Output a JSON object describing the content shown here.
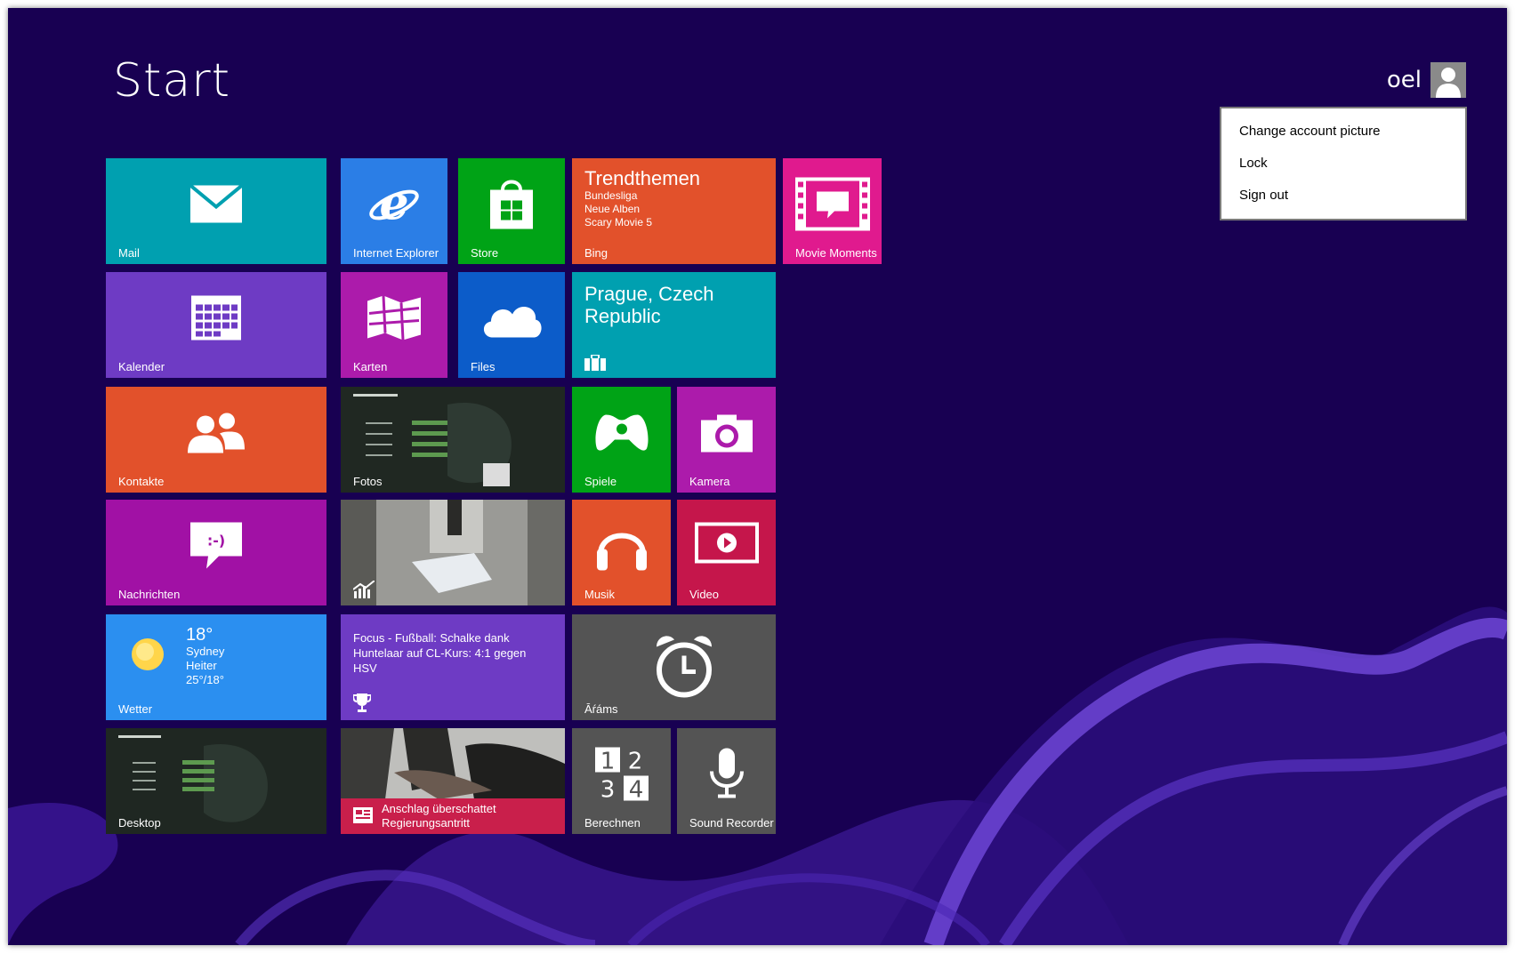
{
  "start": {
    "title": "Start"
  },
  "user": {
    "name": "oel"
  },
  "user_menu": {
    "items": [
      "Change account picture",
      "Lock",
      "Sign out"
    ]
  },
  "tiles": {
    "mail": "Mail",
    "ie": "Internet Explorer",
    "store": "Store",
    "kalender": "Kalender",
    "karten": "Karten",
    "files": "Files",
    "kontakte": "Kontakte",
    "fotos": "Fotos",
    "nachrichten": "Nachrichten",
    "desktop": "Desktop",
    "movie_moments": "Movie Moments",
    "spiele": "Spiele",
    "kamera": "Kamera",
    "musik": "Musik",
    "video": "Video",
    "alarms": "Āŕáms",
    "berechnen": "Berechnen",
    "sound_recorder": "Sound Recorder"
  },
  "weather": {
    "temp": "18°",
    "city": "Sydney",
    "condition": "Heiter",
    "range": "25°/18°",
    "label": "Wetter"
  },
  "sports_news": {
    "text": "Focus - Fußball: Schalke dank Huntelaar auf CL-Kurs: 4:1 gegen HSV"
  },
  "news": {
    "line1": "Anschlag überschattet",
    "line2": "Regierungsantritt"
  },
  "trending": {
    "title": "Trendthemen",
    "items": [
      "Bundesliga",
      "Neue Alben",
      "Scary Movie 5"
    ],
    "label": "Bing"
  },
  "travel": {
    "title": "Prague, Czech Republic"
  },
  "colors": {
    "background": "#180052",
    "mail": "#00a0b0",
    "ie": "#2b7ee6",
    "store": "#00a316",
    "kalender": "#6e3bc4",
    "karten": "#ac1bab",
    "files": "#0c5cc9",
    "kontakte": "#e2512b",
    "nachrichten": "#a111a5",
    "weather": "#2b8ff0",
    "sports": "#6e3bc4",
    "news_bar": "#c91f4b",
    "trending": "#e2512b",
    "movie_moments": "#e01a8e",
    "travel": "#00a0b0",
    "spiele": "#00a316",
    "kamera": "#ac1bab",
    "musik": "#e2512b",
    "video": "#c5164b",
    "grey": "#545454"
  }
}
